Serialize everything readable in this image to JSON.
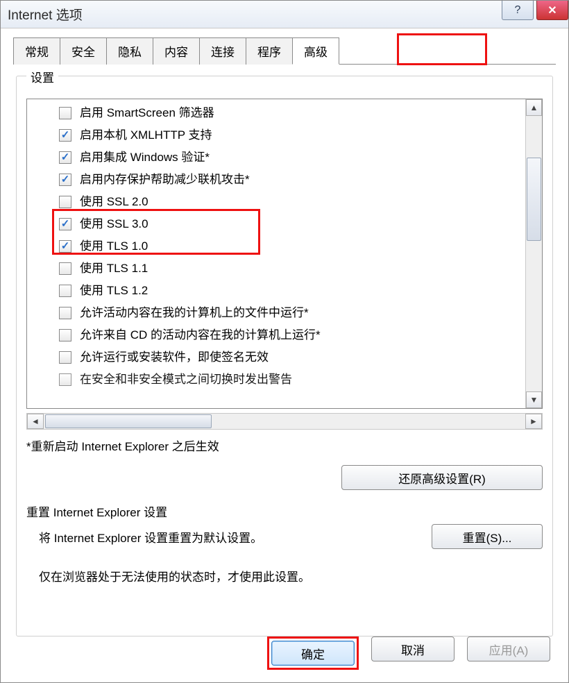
{
  "window": {
    "title": "Internet 选项",
    "help_glyph": "?",
    "close_glyph": "✕"
  },
  "tabs": [
    {
      "label": "常规"
    },
    {
      "label": "安全"
    },
    {
      "label": "隐私"
    },
    {
      "label": "内容"
    },
    {
      "label": "连接"
    },
    {
      "label": "程序"
    },
    {
      "label": "高级",
      "active": true
    }
  ],
  "settings": {
    "group_label": "设置",
    "items": [
      {
        "label": "启用 SmartScreen 筛选器",
        "checked": false
      },
      {
        "label": "启用本机 XMLHTTP 支持",
        "checked": true
      },
      {
        "label": "启用集成 Windows 验证*",
        "checked": true
      },
      {
        "label": "启用内存保护帮助减少联机攻击*",
        "checked": true
      },
      {
        "label": "使用 SSL 2.0",
        "checked": false
      },
      {
        "label": "使用 SSL 3.0",
        "checked": true
      },
      {
        "label": "使用 TLS 1.0",
        "checked": true
      },
      {
        "label": "使用 TLS 1.1",
        "checked": false
      },
      {
        "label": "使用 TLS 1.2",
        "checked": false
      },
      {
        "label": "允许活动内容在我的计算机上的文件中运行*",
        "checked": false
      },
      {
        "label": "允许来自 CD 的活动内容在我的计算机上运行*",
        "checked": false
      },
      {
        "label": "允许运行或安装软件，即使签名无效",
        "checked": false
      },
      {
        "label": "在安全和非安全模式之间切换时发出警告",
        "checked": false
      }
    ],
    "restart_note": "*重新启动 Internet Explorer 之后生效",
    "restore_button": "还原高级设置(R)"
  },
  "reset": {
    "heading": "重置 Internet Explorer 设置",
    "desc": "将 Internet Explorer 设置重置为默认设置。",
    "button": "重置(S)...",
    "note": "仅在浏览器处于无法使用的状态时，才使用此设置。"
  },
  "dialog": {
    "ok": "确定",
    "cancel": "取消",
    "apply": "应用(A)"
  }
}
